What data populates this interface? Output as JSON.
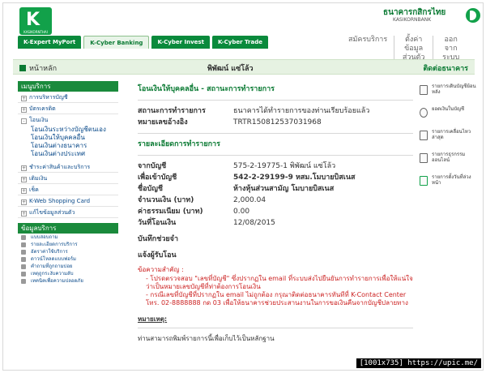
{
  "brand": {
    "logo_text": "K",
    "logo_sub": "KASIKORNTHAI",
    "bank_name_th": "ธนาคารกสิกรไทย",
    "bank_name_en": "KASIKORNBANK"
  },
  "nav": {
    "tabs": [
      "K-Expert MyPort",
      "K-Cyber Banking",
      "K-Cyber Invest",
      "K-Cyber Trade"
    ],
    "active": "K-Cyber Banking"
  },
  "top_links": [
    "สมัครบริการ",
    "ตั้งค่าข้อมูลส่วนตัว",
    "ออกจากระบบ"
  ],
  "bar": {
    "home": "หน้าหลัก",
    "user": "พิพัฒน์ แซ่โล้ว",
    "contact": "ติดต่อธนาคาร"
  },
  "sidebar": {
    "menu_title": "เมนูบริการ",
    "items": [
      "การบริหารบัญชี",
      "บัตรเครดิต",
      "โอนเงิน"
    ],
    "transfer_sub": [
      "โอนเงินระหว่างบัญชีตนเอง",
      "โอนเงินให้บุคคลอื่น",
      "โอนเงินต่างธนาคาร",
      "โอนเงินต่างประเทศ"
    ],
    "items2": [
      "ชำระค่าสินค้าและบริการ",
      "เติมเงิน",
      "เช็ค",
      "K-Web Shopping Card",
      "แก้ไขข้อมูลส่วนตัว"
    ],
    "info_title": "ข้อมูลบริการ",
    "info_items": [
      "แบบสอบถาม",
      "รายละเอียดการบริการ",
      "อัตราค่าใช้บริการ",
      "ดาวน์โหลดแบบฟอร์ม",
      "คำถามที่ถูกถามบ่อย",
      "เหตุถูกระงับความลับ",
      "เทคนิคเพื่อความปลอดภัย"
    ]
  },
  "main": {
    "title": "โอนเงินให้บุคคลอื่น - สถานะการทำรายการ",
    "status_label": "สถานะการทำรายการ",
    "status_value": "ธนาคารได้ทำรายการของท่านเรียบร้อยแล้ว",
    "ref_label": "หมายเลขอ้างอิง",
    "ref_value": "TRTR150812537031968",
    "details_title": "รายละเอียดการทำรายการ",
    "from_label": "จากบัญชี",
    "from_value": "575-2-19775-1 พิพัฒน์ แซ่โล้ว",
    "to_label": "เพื่อเข้าบัญชี",
    "to_value": "542-2-29199-9 หสม.โมบายบิสเนส",
    "name_label": "ชื่อบัญชี",
    "name_value": "ห้างหุ้นส่วนสามัญ โมบายบิสเนส",
    "amount_label": "จำนวนเงิน (บาท)",
    "amount_value": "2,000.04",
    "fee_label": "ค่าธรรมเนียม (บาท)",
    "fee_value": "0.00",
    "date_label": "วันที่โอนเงิน",
    "date_value": "12/08/2015",
    "memo_label": "บันทึกช่วยจำ",
    "notify_label": "แจ้งผู้รับโอน",
    "notice_title": "ข้อความสำคัญ :",
    "notice_1": "- โปรดตรวจสอบ \"เลขที่บัญชี\" ซึ่งปรากฏใน email ที่ระบบส่งไปยืนยันการทำรายการเพื่อให้แน่ใจว่าเป็นหมายเลขบัญชีที่ท่าต้องการโอนเงิน",
    "notice_2": "- กรณีเลขที่บัญชีที่ปรากฏใน email ไม่ถูกต้อง กรุณาติดต่อธนาคารทันทีที่ K-Contact Center โทร. 02-8888888 กด 03 เพื่อให้ธนาคารช่วยประสานงานในการขอเงินคืนจากบัญชีปลายทาง",
    "remark_title": "หมายเหตุ:",
    "remark": "ท่านสามารถพิมพ์รายการนี้เพื่อเก็บไว้เป็นหลักฐาน"
  },
  "tools": [
    "รายการเดินบัญชีย้อนหลัง",
    "ยอดเงินในบัญชี",
    "รายการเคลื่อนไหวล่าสุด",
    "รายการธุรกรรมออนไลน์",
    "รายการตั้งวันที่ล่วงหน้า"
  ],
  "watermark": "[1001x735] https://upic.me/"
}
